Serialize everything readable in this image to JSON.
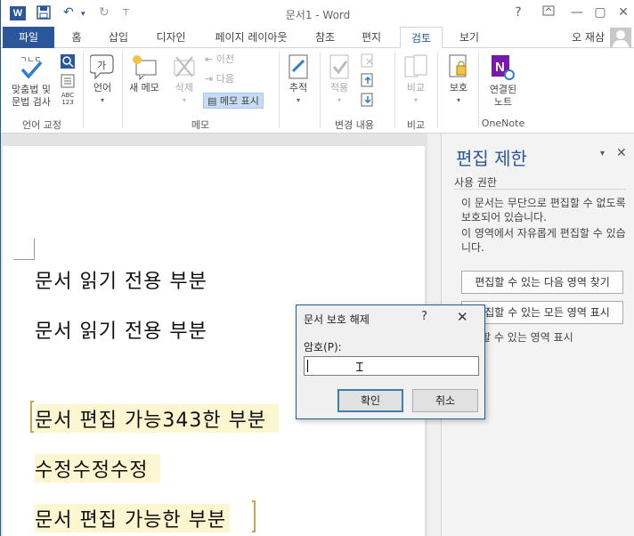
{
  "window": {
    "title": "문서1 - Word",
    "logo": "W",
    "help": "?",
    "minimize": "—",
    "restore": "▢",
    "close": "✕"
  },
  "quick_access": {
    "save_icon": "💾",
    "undo": "↶",
    "undo_caret": "▾",
    "redo": "↻",
    "customize": "⊤"
  },
  "tabs": [
    "파일",
    "홈",
    "삽입",
    "디자인",
    "페이지 레이아웃",
    "참조",
    "편지",
    "검토",
    "보기"
  ],
  "user": {
    "name": "오 재삼"
  },
  "ribbon": {
    "proofing": {
      "spell_label": "맞춤법 및\n문법 검사",
      "group": "언어 교정",
      "wordcount_label": "ㄱㄴㄷ",
      "wc_number": "ABC\n123"
    },
    "language": {
      "label": "언어"
    },
    "comments": {
      "new": "새 메모",
      "delete": "삭제",
      "previous": "이전",
      "next": "다음",
      "show": "메모 표시",
      "group": "메모"
    },
    "tracking": {
      "label": "추적",
      "group": ""
    },
    "changes": {
      "accept": "적용",
      "group": "변경 내용"
    },
    "compare": {
      "label": "비교",
      "group": "비교"
    },
    "protect": {
      "label": "보호",
      "group": ""
    },
    "onenote": {
      "label": "연결된\n노트",
      "group": "OneNote",
      "icon_letter": "N"
    }
  },
  "document": {
    "lines": [
      "문서 읽기 전용 부분",
      "문서 읽기 전용 부분",
      "문서 편집 가능343한 부분",
      "수정수정수정",
      "문서 편집 가능한 부분"
    ]
  },
  "pane": {
    "title": "편집 제한",
    "menu_caret": "▾",
    "close": "✕",
    "section": "사용 권한",
    "text1": "이 문서는 무단으로 편집할 수 없도록 보호되어 있습니다.",
    "text2": "이 영역에서 자유롭게 편집할 수 있습니다.",
    "btn_find_next": "편집할 수 있는 다음 영역 찾기",
    "btn_show_all": "편집할 수 있는 모든 영역 표시",
    "check_highlight": "편집할 수 있는 영역 표시"
  },
  "dialog": {
    "title": "문서 보호 해제",
    "help": "?",
    "close": "✕",
    "label": "암호(P):",
    "password_value": "",
    "ok": "확인",
    "cancel": "취소"
  },
  "colors": {
    "accent": "#2b579a",
    "highlight": "#fcf6d1",
    "bracket": "#c9a74b",
    "onenote": "#7719aa"
  }
}
